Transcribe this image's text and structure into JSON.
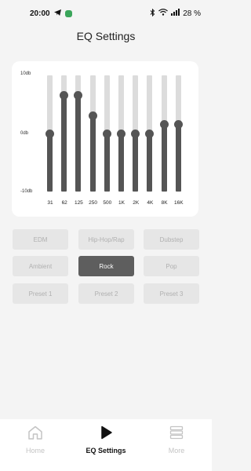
{
  "status_bar": {
    "time": "20:00",
    "battery": "28 %",
    "icons": [
      "telegram-icon",
      "app-icon",
      "bluetooth-icon",
      "wifi-icon",
      "signal-icon",
      "battery-icon"
    ]
  },
  "header": {
    "title": "EQ Settings"
  },
  "equalizer": {
    "db_labels": {
      "top": "10db",
      "mid": "0db",
      "bottom": "-10db"
    },
    "range_db": [
      -10,
      10
    ],
    "bands": [
      {
        "label": "31",
        "gain_db": 0
      },
      {
        "label": "62",
        "gain_db": 6.5
      },
      {
        "label": "125",
        "gain_db": 6.5
      },
      {
        "label": "250",
        "gain_db": 3
      },
      {
        "label": "500",
        "gain_db": 0
      },
      {
        "label": "1K",
        "gain_db": 0
      },
      {
        "label": "2K",
        "gain_db": 0
      },
      {
        "label": "4K",
        "gain_db": 0
      },
      {
        "label": "8K",
        "gain_db": 1.5
      },
      {
        "label": "16K",
        "gain_db": 1.5
      }
    ],
    "colors": {
      "fill": "#555555",
      "track": "#dcdcdc"
    }
  },
  "presets": [
    {
      "label": "EDM",
      "active": false
    },
    {
      "label": "Hip-Hop/Rap",
      "active": false
    },
    {
      "label": "Dubstep",
      "active": false
    },
    {
      "label": "Ambient",
      "active": false
    },
    {
      "label": "Rock",
      "active": true
    },
    {
      "label": "Pop",
      "active": false
    },
    {
      "label": "Preset 1",
      "active": false
    },
    {
      "label": "Preset 2",
      "active": false
    },
    {
      "label": "Preset 3",
      "active": false
    }
  ],
  "bottom_nav": {
    "items": [
      {
        "label": "Home",
        "icon": "home-icon",
        "active": false
      },
      {
        "label": "EQ Settings",
        "icon": "play-icon",
        "active": true
      },
      {
        "label": "More",
        "icon": "menu-icon",
        "active": false
      }
    ]
  }
}
